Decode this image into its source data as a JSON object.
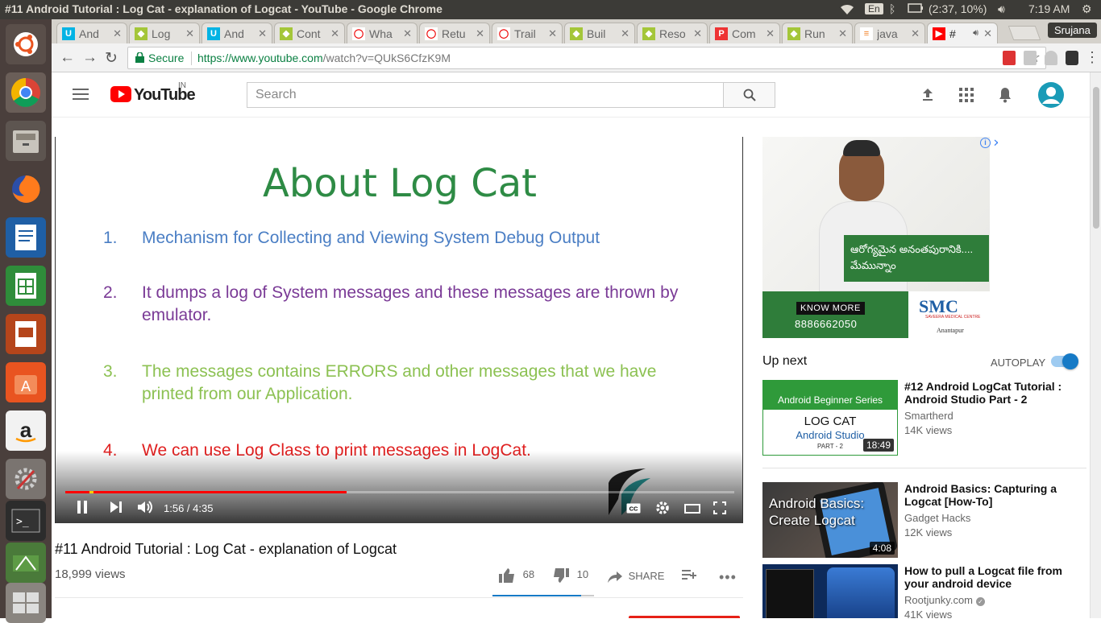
{
  "window_title": "#11 Android Tutorial : Log Cat - explanation of Logcat - YouTube - Google Chrome",
  "system_tray": {
    "language": "En",
    "battery": "(2:37, 10%)",
    "clock": "7:19 AM"
  },
  "browser": {
    "tabs": [
      {
        "label": "And",
        "favicon": "udacity"
      },
      {
        "label": "Log",
        "favicon": "android"
      },
      {
        "label": "And",
        "favicon": "udacity"
      },
      {
        "label": "Cont",
        "favicon": "android"
      },
      {
        "label": "Wha",
        "favicon": "oracle"
      },
      {
        "label": "Retu",
        "favicon": "oracle"
      },
      {
        "label": "Trail",
        "favicon": "oracle"
      },
      {
        "label": "Buil",
        "favicon": "android"
      },
      {
        "label": "Reso",
        "favicon": "android"
      },
      {
        "label": "Com",
        "favicon": "pdf"
      },
      {
        "label": "Run",
        "favicon": "android"
      },
      {
        "label": "java",
        "favicon": "stackoverflow"
      },
      {
        "label": "#",
        "favicon": "youtube"
      }
    ],
    "profile_name": "Srujana",
    "secure_label": "Secure",
    "url_scheme_host": "https://www.youtube.com",
    "url_path": "/watch?v=QUkS6CfzK9M"
  },
  "youtube": {
    "region": "IN",
    "search_placeholder": "Search",
    "slide": {
      "title": "About Log Cat",
      "points": [
        {
          "num": "1.",
          "text": "Mechanism for Collecting and Viewing System Debug Output",
          "color": "#4a7ec4"
        },
        {
          "num": "2.",
          "text": "It dumps a log of System messages and these messages are thrown by emulator.",
          "color": "#7a3a96"
        },
        {
          "num": "3.",
          "text": "The messages contains ERRORS and other messages that we have printed from our Application.",
          "color": "#8cc152"
        },
        {
          "num": "4.",
          "text": "We can use Log Class to print messages in LogCat.",
          "color": "#e02020"
        }
      ]
    },
    "player": {
      "time": "1:56 / 4:35",
      "progress_fraction": 0.421
    },
    "video_title": "#11 Android Tutorial : Log Cat - explanation of Logcat",
    "views": "18,999 views",
    "likes": "68",
    "dislikes": "10",
    "share_label": "SHARE",
    "ad": {
      "telugu_text": "ఆరోగ్యమైన అనంతపురానికి.... మేమున్నాం",
      "know_more": "KNOW MORE",
      "phone": "8886662050",
      "brand": "SMC",
      "brand_sub": "SAVEERA MEDICAL CENTRE",
      "city": "Anantapur"
    },
    "up_next_label": "Up next",
    "autoplay_label": "AUTOPLAY",
    "recommendations": [
      {
        "title": "#12 Android LogCat Tutorial : Android Studio Part - 2",
        "channel": "Smartherd",
        "views": "14K views",
        "duration": "18:49",
        "thumb_top": "Android Beginner Series",
        "thumb_main": "LOG CAT",
        "thumb_sub": "Android Studio",
        "thumb_part": "PART - 2"
      },
      {
        "title": "Android Basics: Capturing a Logcat [How-To]",
        "channel": "Gadget Hacks",
        "views": "12K views",
        "duration": "4:08",
        "thumb_main": "Android Basics: Create Logcat"
      },
      {
        "title": "How to pull a Logcat file from your android device",
        "channel": "Rootjunky.com",
        "views": "41K views"
      }
    ]
  }
}
